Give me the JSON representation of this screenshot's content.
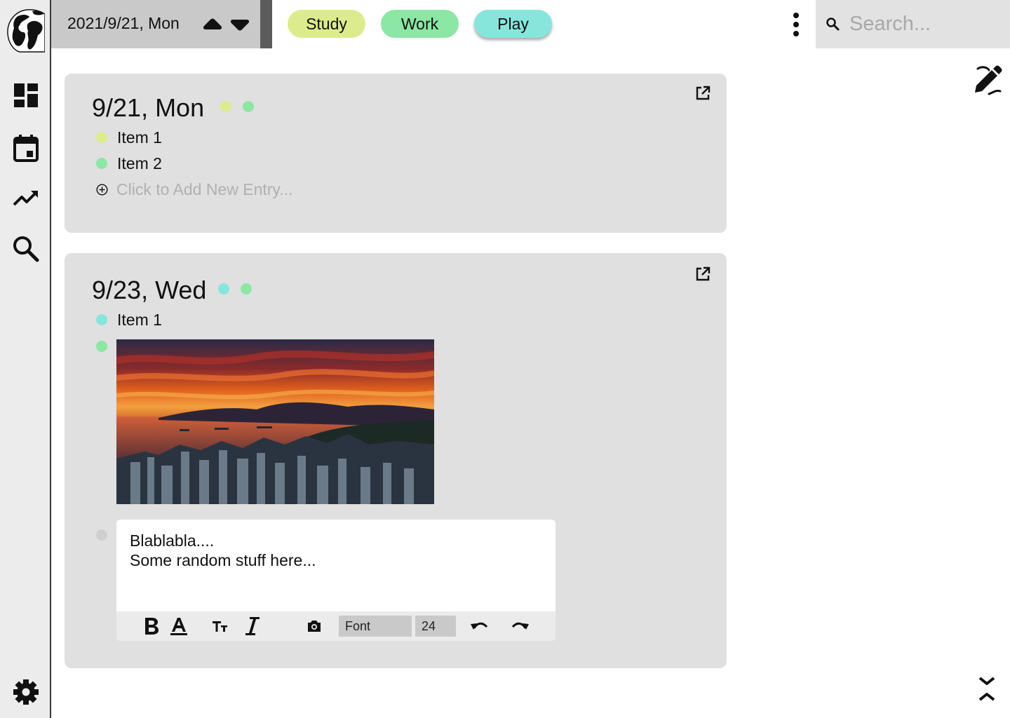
{
  "header": {
    "date": "2021/9/21, Mon",
    "tags": [
      {
        "label": "Study",
        "color": "#dcec8c"
      },
      {
        "label": "Work",
        "color": "#8ce6a4"
      },
      {
        "label": "Play",
        "color": "#86e6dc"
      }
    ],
    "search_placeholder": "Search..."
  },
  "sidebar": {
    "items": [
      {
        "icon": "dashboard-icon"
      },
      {
        "icon": "calendar-icon"
      },
      {
        "icon": "trending-icon"
      },
      {
        "icon": "search-icon"
      }
    ],
    "bottom_icon": "settings-icon"
  },
  "colors": {
    "study": "#dcec8c",
    "work": "#8ce6a4",
    "play": "#86e6dc",
    "card_bg": "#e0e0e0",
    "sidebar_bg": "#ececec"
  },
  "cards": [
    {
      "title": "9/21, Mon",
      "entries": [
        {
          "label": "Item 1",
          "tag": "study"
        },
        {
          "label": "Item 2",
          "tag": "work"
        }
      ],
      "add_placeholder": "Click to Add New Entry..."
    },
    {
      "title": "9/23, Wed",
      "entries": [
        {
          "label": "Item 1",
          "tag": "play"
        }
      ],
      "editor": {
        "line1": "Blablabla....",
        "line2": "Some random stuff here...",
        "font_label": "Font",
        "font_size": "24"
      }
    }
  ]
}
